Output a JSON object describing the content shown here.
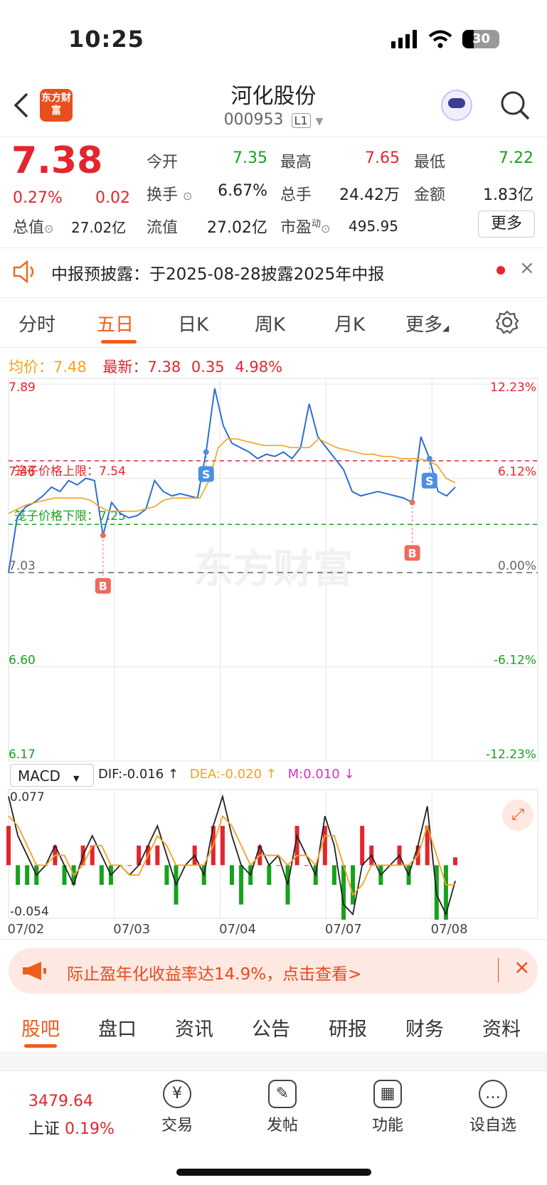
{
  "status_bar": {
    "time": "10:25",
    "battery": "30"
  },
  "header": {
    "logo": "东方财富",
    "title": "河化股份",
    "code": "000953",
    "level": "L1"
  },
  "quote": {
    "price": "7.38",
    "change_pct": "0.27%",
    "change": "0.02",
    "open_label": "今开",
    "open": "7.35",
    "high_label": "最高",
    "high": "7.65",
    "low_label": "最低",
    "low": "7.22",
    "turnover_label": "换手",
    "turnover": "6.67%",
    "volume_label": "总手",
    "volume": "24.42万",
    "amount_label": "金额",
    "amount": "1.83亿",
    "total_mv_label": "总值",
    "total_mv": "27.02亿",
    "float_mv_label": "流值",
    "float_mv": "27.02亿",
    "pe_label": "市盈",
    "pe_sup": "动",
    "pe": "495.95",
    "more_btn": "更多"
  },
  "notice": {
    "text": "中报预披露：于2025-08-28披露2025年中报"
  },
  "chart_tabs": [
    "分时",
    "五日",
    "日K",
    "周K",
    "月K",
    "更多"
  ],
  "summary": {
    "avg_label": "均价：",
    "avg": "7.48",
    "latest_label": "最新：",
    "latest": "7.38",
    "chg": "0.35",
    "chg_pct": "4.98%"
  },
  "chart_data": {
    "type": "line",
    "y_left_ticks": [
      "7.89",
      "7.46",
      "7.03",
      "6.60",
      "6.17"
    ],
    "y_right_ticks": [
      "12.23%",
      "6.12%",
      "0.00%",
      "-6.12%",
      "-12.23%"
    ],
    "x_labels": [
      "07/02",
      "07/03",
      "07/04",
      "07/07",
      "07/08"
    ],
    "ylim": [
      6.17,
      7.89
    ],
    "upper_limit_label": "笼子价格上限：7.54",
    "upper_limit": 7.54,
    "lower_limit_label": "笼子价格下限：7.25",
    "lower_limit": 7.25,
    "prev_close": 7.03,
    "watermark": "东方财富",
    "series": [
      {
        "values": [
          7.03,
          7.28,
          7.33,
          7.35,
          7.38,
          7.42,
          7.4,
          7.45,
          7.43,
          7.46,
          7.45,
          7.2,
          7.35,
          7.3,
          7.28,
          7.29,
          7.32,
          7.45,
          7.4,
          7.38,
          7.39,
          7.38,
          7.37,
          7.58,
          7.87,
          7.7,
          7.62,
          7.6,
          7.58,
          7.55,
          7.57,
          7.56,
          7.58,
          7.55,
          7.6,
          7.8,
          7.65,
          7.6,
          7.55,
          7.5,
          7.4,
          7.38,
          7.39,
          7.4,
          7.39,
          7.38,
          7.37,
          7.35,
          7.65,
          7.55,
          7.4,
          7.38,
          7.42
        ]
      },
      {
        "values": [
          7.3,
          7.32,
          7.34,
          7.35,
          7.36,
          7.37,
          7.37,
          7.37,
          7.37,
          7.36,
          7.33,
          7.31,
          7.31,
          7.31,
          7.31,
          7.32,
          7.33,
          7.36,
          7.37,
          7.37,
          7.37,
          7.37,
          7.45,
          7.6,
          7.64,
          7.64,
          7.63,
          7.62,
          7.61,
          7.61,
          7.61,
          7.6,
          7.6,
          7.6,
          7.64,
          7.62,
          7.6,
          7.59,
          7.58,
          7.57,
          7.57,
          7.56,
          7.56,
          7.55,
          7.55,
          7.55,
          7.54,
          7.52,
          7.46,
          7.44
        ]
      }
    ],
    "markers": [
      {
        "label": "B",
        "index": 11
      },
      {
        "label": "S",
        "index": 23
      },
      {
        "label": "B",
        "index": 47
      },
      {
        "label": "S",
        "index": 49
      }
    ],
    "macd": {
      "select": "MACD",
      "dif_label": "DIF:-0.016 ↑",
      "dea_label": "DEA:-0.020 ↑",
      "m_label": "M:0.010 ↓",
      "top": "0.077",
      "bottom": "-0.054",
      "dif": [
        0.07,
        0.03,
        0.01,
        -0.01,
        0.0,
        0.02,
        0.0,
        -0.02,
        0.01,
        0.03,
        0.01,
        -0.01,
        0.0,
        -0.01,
        0.0,
        0.02,
        0.04,
        0.01,
        -0.02,
        0.0,
        0.01,
        -0.01,
        0.04,
        0.07,
        0.03,
        0.0,
        -0.01,
        0.02,
        0.0,
        0.01,
        -0.02,
        0.03,
        0.01,
        -0.01,
        0.05,
        0.02,
        -0.04,
        -0.05,
        0.0,
        0.01,
        -0.01,
        0.0,
        0.01,
        -0.01,
        0.02,
        0.06,
        -0.03,
        -0.05,
        -0.016
      ],
      "dea": [
        0.05,
        0.04,
        0.02,
        0.0,
        0.0,
        0.01,
        0.01,
        -0.01,
        0.0,
        0.02,
        0.02,
        0.0,
        0.0,
        -0.01,
        -0.01,
        0.01,
        0.03,
        0.02,
        0.0,
        0.0,
        0.0,
        0.0,
        0.02,
        0.05,
        0.04,
        0.02,
        0.0,
        0.01,
        0.01,
        0.01,
        0.0,
        0.01,
        0.01,
        0.0,
        0.03,
        0.03,
        0.0,
        -0.03,
        -0.02,
        0.0,
        0.0,
        0.0,
        0.0,
        0.0,
        0.01,
        0.04,
        0.01,
        -0.02,
        -0.02
      ]
    }
  },
  "banner": {
    "text": "际止盈年化收益率达14.9%，点击查看>"
  },
  "bottom_tabs": [
    "股吧",
    "盘口",
    "资讯",
    "公告",
    "研报",
    "财务",
    "资料"
  ],
  "footer": {
    "index_value": "3479.64",
    "index_name": "上证",
    "index_pct": "0.19%",
    "items": [
      {
        "label": "交易",
        "icon": "¥"
      },
      {
        "label": "发帖",
        "icon": "✎"
      },
      {
        "label": "功能",
        "icon": "▦"
      },
      {
        "label": "设自选",
        "icon": "…"
      }
    ]
  }
}
